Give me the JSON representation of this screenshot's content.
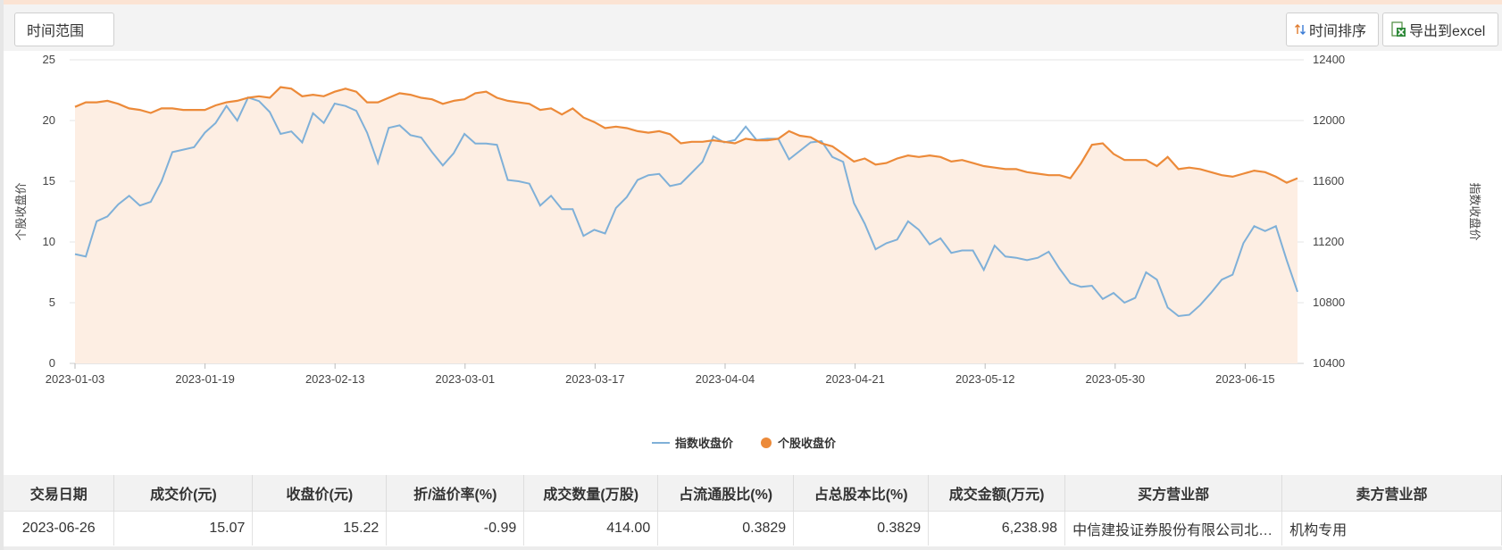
{
  "toolbar": {
    "range_label": "时间范围",
    "sort_label": "时间排序",
    "export_label": "导出到excel"
  },
  "colors": {
    "index_line": "#7fb0d8",
    "stock_line": "#ec8a39",
    "stock_fill": "#fdeee3",
    "header_bg": "#f2f2f2"
  },
  "chart_data": {
    "type": "line",
    "left_axis": {
      "label": "个股收盘价",
      "ticks": [
        "25",
        "20",
        "15",
        "10",
        "5",
        "0"
      ],
      "range": [
        0,
        25
      ]
    },
    "right_axis": {
      "label": "指数收盘价",
      "ticks": [
        "12400",
        "12000",
        "11600",
        "11200",
        "10800",
        "10400"
      ],
      "range": [
        10400,
        12400
      ]
    },
    "x_ticks": [
      "2023-01-03",
      "2023-01-19",
      "2023-02-13",
      "2023-03-01",
      "2023-03-17",
      "2023-04-04",
      "2023-04-21",
      "2023-05-12",
      "2023-05-30",
      "2023-06-15"
    ],
    "grid": true,
    "legend_position": "bottom-center",
    "series": [
      {
        "name": "指数收盘价",
        "axis": "left",
        "color": "#7fb0d8",
        "values": [
          9.0,
          8.8,
          11.7,
          12.1,
          13.1,
          13.8,
          13.0,
          13.3,
          15.0,
          17.4,
          17.6,
          17.8,
          19.0,
          19.8,
          21.2,
          20.0,
          21.9,
          21.6,
          20.7,
          18.9,
          19.1,
          18.2,
          20.6,
          19.8,
          21.4,
          21.2,
          20.8,
          19.0,
          16.5,
          19.4,
          19.6,
          18.8,
          18.6,
          17.4,
          16.3,
          17.3,
          18.9,
          18.1,
          18.1,
          18.0,
          15.1,
          15.0,
          14.8,
          13.0,
          13.8,
          12.7,
          12.7,
          10.5,
          11.0,
          10.7,
          12.8,
          13.7,
          15.1,
          15.5,
          15.6,
          14.6,
          14.8,
          15.7,
          16.6,
          18.7,
          18.2,
          18.4,
          19.5,
          18.4,
          18.5,
          18.5,
          16.8,
          17.5,
          18.2,
          18.3,
          17.0,
          16.6,
          13.2,
          11.5,
          9.4,
          9.9,
          10.2,
          11.7,
          11.0,
          9.8,
          10.3,
          9.1,
          9.3,
          9.3,
          7.7,
          9.7,
          8.8,
          8.7,
          8.5,
          8.7,
          9.2,
          7.8,
          6.6,
          6.3,
          6.4,
          5.3,
          5.8,
          5.0,
          5.4,
          7.5,
          6.9,
          4.6,
          3.9,
          4.0,
          4.8,
          5.8,
          6.9,
          7.3,
          9.9,
          11.3,
          10.9,
          11.3,
          8.5,
          5.9
        ]
      },
      {
        "name": "个股收盘价",
        "axis": "right",
        "color": "#ec8a39",
        "values": [
          12090,
          12120,
          12120,
          12130,
          12110,
          12080,
          12070,
          12050,
          12080,
          12080,
          12070,
          12070,
          12070,
          12100,
          12120,
          12130,
          12150,
          12160,
          12150,
          12220,
          12210,
          12160,
          12170,
          12160,
          12190,
          12210,
          12190,
          12120,
          12120,
          12150,
          12180,
          12170,
          12150,
          12140,
          12110,
          12130,
          12140,
          12180,
          12190,
          12150,
          12130,
          12120,
          12110,
          12070,
          12080,
          12040,
          12080,
          12020,
          11990,
          11950,
          11960,
          11950,
          11930,
          11920,
          11930,
          11910,
          11850,
          11860,
          11860,
          11870,
          11860,
          11850,
          11880,
          11870,
          11870,
          11880,
          11930,
          11900,
          11890,
          11850,
          11830,
          11780,
          11730,
          11750,
          11710,
          11720,
          11750,
          11770,
          11760,
          11770,
          11760,
          11730,
          11740,
          11720,
          11700,
          11690,
          11680,
          11680,
          11660,
          11650,
          11640,
          11640,
          11620,
          11720,
          11840,
          11850,
          11780,
          11740,
          11740,
          11740,
          11700,
          11760,
          11680,
          11690,
          11680,
          11660,
          11640,
          11630,
          11650,
          11670,
          11660,
          11630,
          11590,
          11620
        ]
      }
    ]
  },
  "table": {
    "columns": [
      "交易日期",
      "成交价(元)",
      "收盘价(元)",
      "折/溢价率(%)",
      "成交数量(万股)",
      "占流通股比(%)",
      "占总股本比(%)",
      "成交金额(万元)",
      "买方营业部",
      "卖方营业部"
    ],
    "rows": [
      [
        "2023-06-26",
        "15.07",
        "15.22",
        "-0.99",
        "414.00",
        "0.3829",
        "0.3829",
        "6,238.98",
        "中信建投证券股份有限公司北…",
        "机构专用"
      ]
    ]
  }
}
